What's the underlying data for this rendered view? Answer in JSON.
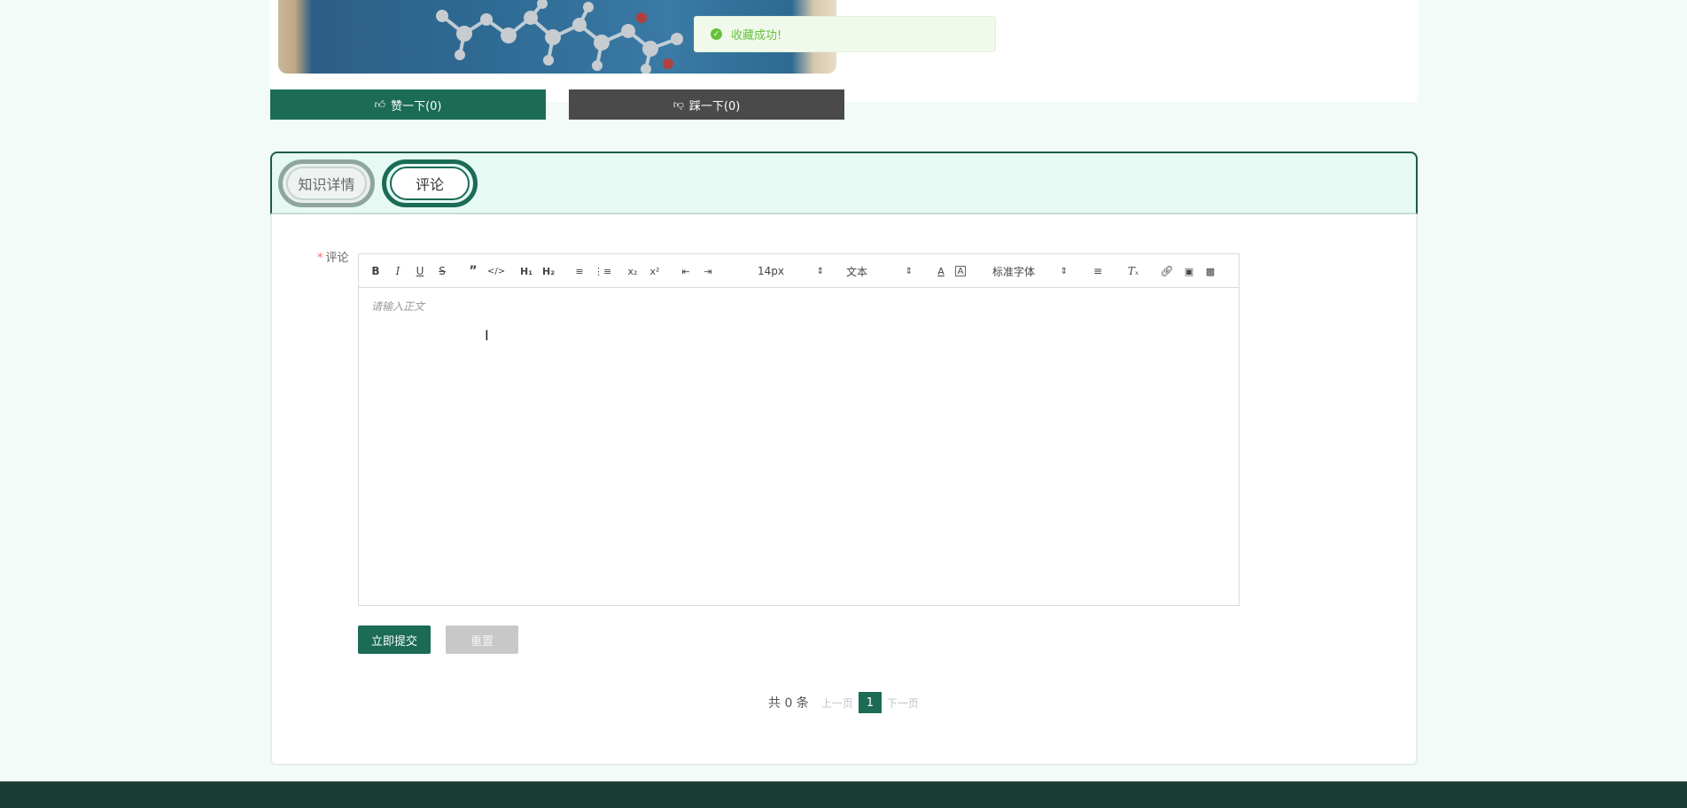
{
  "actions": {
    "like_label": "赞一下(0)",
    "dislike_label": "踩一下(0)"
  },
  "toast": {
    "message": "收藏成功!",
    "type": "success",
    "color": "#67c23a"
  },
  "tabs": [
    {
      "label": "知识详情",
      "active": false
    },
    {
      "label": "评论",
      "active": true
    }
  ],
  "form": {
    "comment_label": "评论",
    "required_mark": "*",
    "editor": {
      "placeholder": "请输入正文",
      "font_size_value": "14px",
      "header_value": "文本",
      "font_family_value": "标准字体",
      "toolbar": [
        "bold",
        "italic",
        "underline",
        "strike",
        "blockquote",
        "code-block",
        "h1",
        "h2",
        "ordered-list",
        "bullet-list",
        "subscript",
        "superscript",
        "outdent",
        "indent",
        "font-size",
        "header",
        "font-color",
        "background-color",
        "font-family",
        "align",
        "clean",
        "link",
        "image",
        "video"
      ]
    },
    "submit_label": "立即提交",
    "reset_label": "重置"
  },
  "pagination": {
    "total_text": "共 0 条",
    "prev_label": "上一页",
    "current_page": "1",
    "next_label": "下一页"
  },
  "colors": {
    "primary": "#1b6b55",
    "dark_button": "#4a4a4a",
    "footer": "#1c3d33",
    "background": "#f2fbf8"
  }
}
